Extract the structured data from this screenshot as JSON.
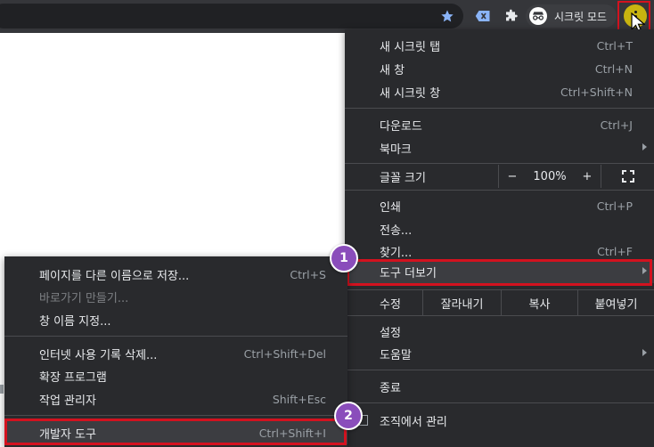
{
  "toolbar": {
    "incognito_label": "시크릿 모드",
    "icons": [
      "star-icon",
      "extension-icon-1",
      "puzzle-icon",
      "incognito-icon",
      "kebab-menu-icon"
    ],
    "accent_color": "#8ab4f8"
  },
  "main_menu": {
    "items": [
      {
        "label": "새 시크릿 탭",
        "shortcut": "Ctrl+T"
      },
      {
        "label": "새 창",
        "shortcut": "Ctrl+N"
      },
      {
        "label": "새 시크릿 창",
        "shortcut": "Ctrl+Shift+N"
      },
      {
        "label": "다운로드",
        "shortcut": "Ctrl+J"
      },
      {
        "label": "북마크",
        "shortcut": ""
      },
      {
        "label": "인쇄",
        "shortcut": "Ctrl+P"
      },
      {
        "label": "전송...",
        "shortcut": ""
      },
      {
        "label": "찾기...",
        "shortcut": "Ctrl+F"
      },
      {
        "label": "도구 더보기",
        "shortcut": ""
      },
      {
        "label": "설정",
        "shortcut": ""
      },
      {
        "label": "도움말",
        "shortcut": ""
      },
      {
        "label": "종료",
        "shortcut": ""
      },
      {
        "label": "조직에서 관리",
        "shortcut": ""
      }
    ],
    "zoom": {
      "label": "글꼴 크기",
      "minus": "−",
      "value": "100%",
      "plus": "+"
    },
    "edit": {
      "label": "수정",
      "cut": "잘라내기",
      "copy": "복사",
      "paste": "붙여넣기"
    }
  },
  "submenu": {
    "items": [
      {
        "label": "페이지를 다른 이름으로 저장...",
        "shortcut": "Ctrl+S"
      },
      {
        "label": "바로가기 만들기...",
        "shortcut": ""
      },
      {
        "label": "창 이름 지정...",
        "shortcut": ""
      },
      {
        "label": "인터넷 사용 기록 삭제...",
        "shortcut": "Ctrl+Shift+Del"
      },
      {
        "label": "확장 프로그램",
        "shortcut": ""
      },
      {
        "label": "작업 관리자",
        "shortcut": "Shift+Esc"
      },
      {
        "label": "개발자 도구",
        "shortcut": "Ctrl+Shift+I"
      }
    ]
  },
  "badges": {
    "step1": "1",
    "step2": "2"
  },
  "colors": {
    "menu_bg": "#292a2d",
    "highlight": "#d3121f",
    "badge": "#8a4dbb"
  }
}
